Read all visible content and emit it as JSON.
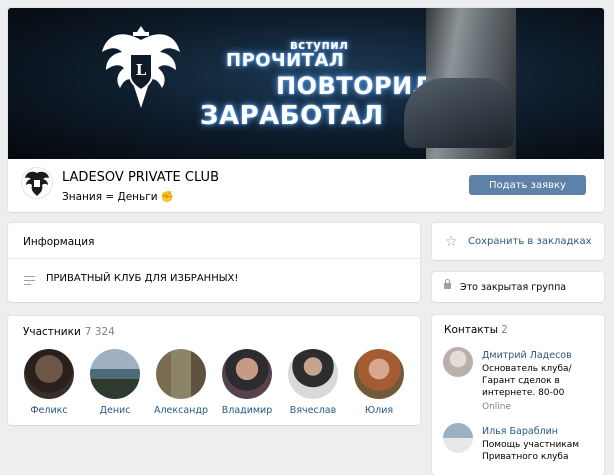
{
  "cover": {
    "line1": "вступил",
    "line2": "ПРОЧИТАЛ",
    "line3": "ПОВТОРИЛ",
    "line4": "ЗАРАБОТАЛ"
  },
  "group": {
    "name": "LADESOV PRIVATE CLUB",
    "status": "Знания = Деньги ✊",
    "join_label": "Подать заявку"
  },
  "info": {
    "title": "Информация",
    "description": "ПРИВАТНЫЙ КЛУБ ДЛЯ ИЗБРАННЫХ!"
  },
  "members": {
    "title": "Участники",
    "count": "7 324",
    "items": [
      {
        "name": "Феликс"
      },
      {
        "name": "Денис"
      },
      {
        "name": "Александр"
      },
      {
        "name": "Владимир"
      },
      {
        "name": "Вячеслав"
      },
      {
        "name": "Юлия"
      }
    ]
  },
  "sidebar": {
    "bookmark_label": "Сохранить в закладках",
    "closed_label": "Это закрытая группа"
  },
  "contacts": {
    "title": "Контакты",
    "count": "2",
    "items": [
      {
        "name": "Дмитрий Ладесов",
        "desc": "Основатель клуба/ Гарант сделок в интернете. 80-00",
        "status": "Online"
      },
      {
        "name": "Илья Бараблин",
        "desc": "Помощь участникам Приватного клуба"
      }
    ]
  },
  "colors": {
    "accent": "#5e81a8",
    "link": "#2a5885",
    "background": "#edeef0"
  }
}
